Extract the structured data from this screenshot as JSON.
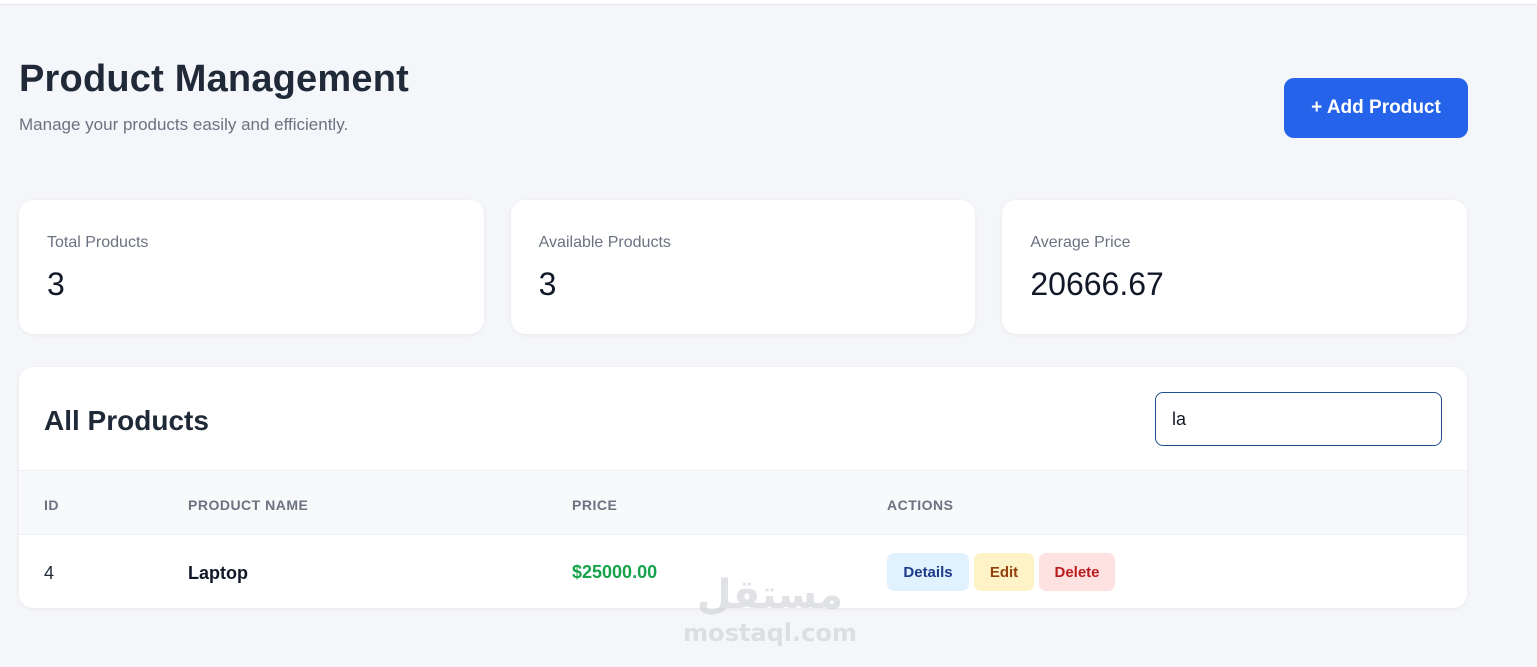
{
  "header": {
    "title": "Product Management",
    "subtitle": "Manage your products easily and efficiently.",
    "add_button_label": "+ Add Product"
  },
  "stats": [
    {
      "label": "Total Products",
      "value": "3"
    },
    {
      "label": "Available Products",
      "value": "3"
    },
    {
      "label": "Average Price",
      "value": "20666.67"
    }
  ],
  "products": {
    "title": "All Products",
    "search_value": "la",
    "columns": [
      "ID",
      "PRODUCT NAME",
      "PRICE",
      "ACTIONS"
    ],
    "rows": [
      {
        "id": "4",
        "name": "Laptop",
        "price": "$25000.00"
      }
    ],
    "actions": {
      "details": "Details",
      "edit": "Edit",
      "delete": "Delete"
    }
  },
  "watermark": {
    "logo": "مستقل",
    "text": "mostaql.com"
  },
  "colors": {
    "accent": "#2563eb",
    "price": "#16a34a",
    "details_bg": "#e0f2fe",
    "edit_bg": "#fef3c7",
    "delete_bg": "#fee2e2"
  }
}
